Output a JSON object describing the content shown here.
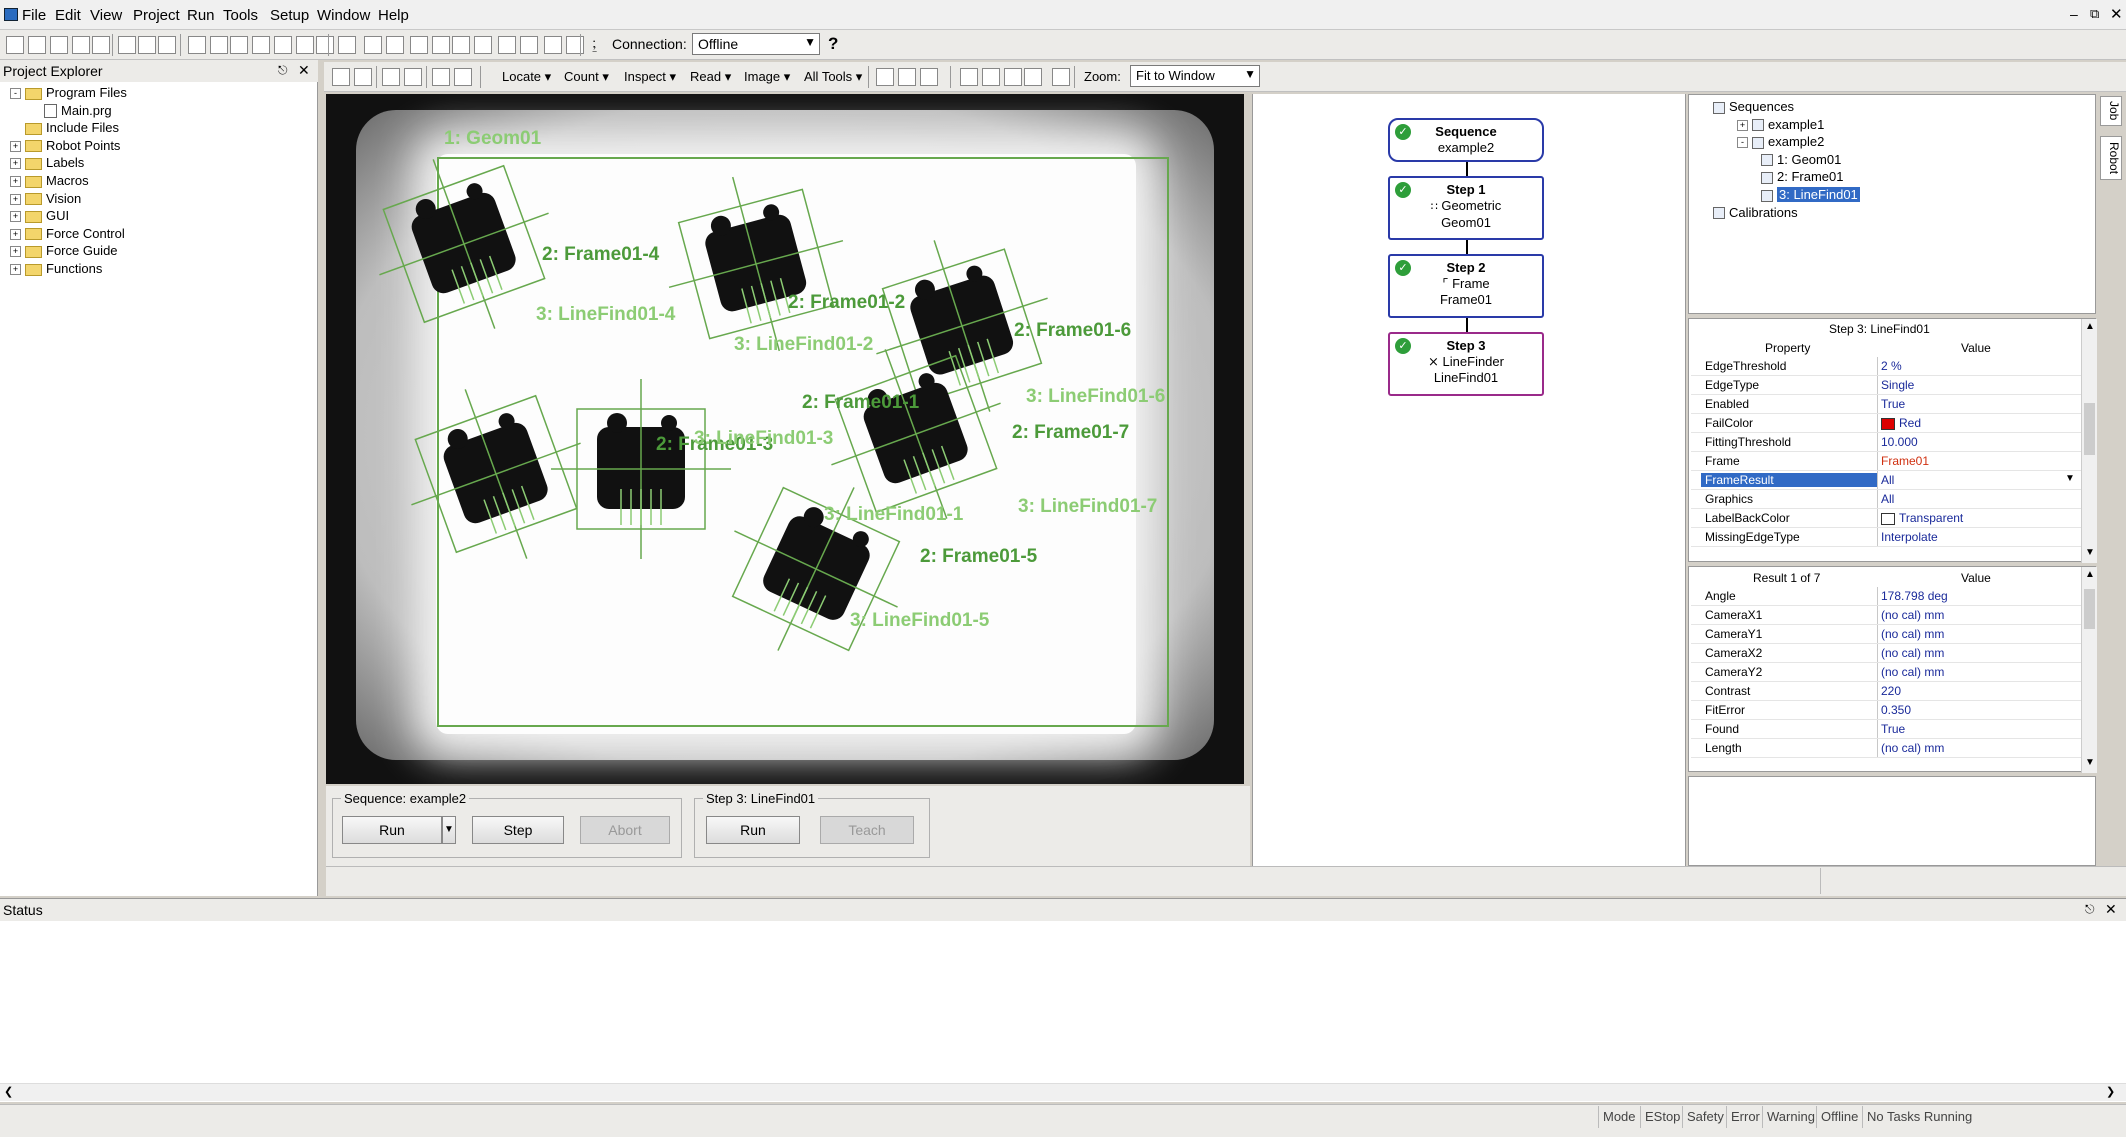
{
  "menu": {
    "items": [
      "File",
      "Edit",
      "View",
      "Project",
      "Run",
      "Tools",
      "Setup",
      "Window",
      "Help"
    ]
  },
  "toolbar": {
    "connection_label": "Connection:",
    "connection_value": "Offline",
    "help_label": "?"
  },
  "vision_toolbar": {
    "menus": [
      "Locate",
      "Count",
      "Inspect",
      "Read",
      "Image",
      "All Tools"
    ],
    "zoom_label": "Zoom:",
    "zoom_value": "Fit to Window"
  },
  "project_explorer": {
    "title": "Project Explorer",
    "items": [
      {
        "label": "Program Files",
        "type": "folder",
        "expand": "-"
      },
      {
        "label": "Main.prg",
        "type": "file",
        "expand": ""
      },
      {
        "label": "Include Files",
        "type": "folder",
        "expand": ""
      },
      {
        "label": "Robot Points",
        "type": "folder",
        "expand": "+"
      },
      {
        "label": "Labels",
        "type": "folder",
        "expand": "+"
      },
      {
        "label": "Macros",
        "type": "folder",
        "expand": "+"
      },
      {
        "label": "Vision",
        "type": "folder",
        "expand": "+"
      },
      {
        "label": "GUI",
        "type": "folder",
        "expand": "+"
      },
      {
        "label": "Force Control",
        "type": "folder",
        "expand": "+"
      },
      {
        "label": "Force Guide",
        "type": "folder",
        "expand": "+"
      },
      {
        "label": "Functions",
        "type": "folder",
        "expand": "+"
      }
    ]
  },
  "image_labels": {
    "geom": "1: Geom01",
    "frames": [
      "2: Frame01-4",
      "2: Frame01-2",
      "2: Frame01-6",
      "2: Frame01-7",
      "2: Frame01-1",
      "2: Frame01-3",
      "2: Frame01-5"
    ],
    "linefinds": [
      "3: LineFind01-4",
      "3: LineFind01-2",
      "3: LineFind01-6",
      "3: LineFind01-3",
      "3: LineFind01-1",
      "3: LineFind01-7",
      "3: LineFind01-5"
    ]
  },
  "sequence_controls": {
    "group_title": "Sequence: example2",
    "run": "Run",
    "step": "Step",
    "abort": "Abort"
  },
  "step_controls": {
    "group_title": "Step 3: LineFind01",
    "run": "Run",
    "teach": "Teach"
  },
  "flow": {
    "sequence": {
      "title": "Sequence",
      "sub": "example2"
    },
    "steps": [
      {
        "title": "Step 1",
        "line1": "Geometric",
        "line2": "Geom01"
      },
      {
        "title": "Step 2",
        "line1": "Frame",
        "line2": "Frame01"
      },
      {
        "title": "Step 3",
        "line1": "LineFinder",
        "line2": "LineFind01"
      }
    ]
  },
  "sequence_tree": {
    "items": [
      {
        "label": "Sequences",
        "level": 0
      },
      {
        "label": "example1",
        "level": 1
      },
      {
        "label": "example2",
        "level": 1
      },
      {
        "label": "1: Geom01",
        "level": 2
      },
      {
        "label": "2: Frame01",
        "level": 2
      },
      {
        "label": "3: LineFind01",
        "level": 2,
        "selected": true
      },
      {
        "label": "Calibrations",
        "level": 0
      }
    ]
  },
  "side_tabs": [
    "Job",
    "Robot"
  ],
  "properties": {
    "title": "Step 3: LineFind01",
    "col_property": "Property",
    "col_value": "Value",
    "rows": [
      {
        "k": "EdgeThreshold",
        "v": "2 %"
      },
      {
        "k": "EdgeType",
        "v": "Single"
      },
      {
        "k": "Enabled",
        "v": "True"
      },
      {
        "k": "FailColor",
        "v": "Red",
        "swatch": "#dd0000"
      },
      {
        "k": "FittingThreshold",
        "v": "10.000"
      },
      {
        "k": "Frame",
        "v": "Frame01",
        "red": true
      },
      {
        "k": "FrameResult",
        "v": "All",
        "selected": true
      },
      {
        "k": "Graphics",
        "v": "All"
      },
      {
        "k": "LabelBackColor",
        "v": "Transparent",
        "swatch": "#ffffff"
      },
      {
        "k": "MissingEdgeType",
        "v": "Interpolate"
      }
    ]
  },
  "results": {
    "title": "Result 1 of 7",
    "col_value": "Value",
    "rows": [
      {
        "k": "Angle",
        "v": "178.798 deg"
      },
      {
        "k": "CameraX1",
        "v": "(no cal) mm"
      },
      {
        "k": "CameraY1",
        "v": "(no cal) mm"
      },
      {
        "k": "CameraX2",
        "v": "(no cal) mm"
      },
      {
        "k": "CameraY2",
        "v": "(no cal) mm"
      },
      {
        "k": "Contrast",
        "v": "220"
      },
      {
        "k": "FitError",
        "v": "0.350"
      },
      {
        "k": "Found",
        "v": "True"
      },
      {
        "k": "Length",
        "v": "(no cal) mm"
      }
    ]
  },
  "status_panel": {
    "title": "Status"
  },
  "statusbar": [
    "Mode",
    "EStop",
    "Safety",
    "Error",
    "Warning",
    "Offline",
    "No Tasks Running"
  ],
  "colors": {
    "accent": "#2a3aa8",
    "success": "#2e9e3a",
    "selection": "#316ac5",
    "overlay": "#4c9a3a"
  }
}
